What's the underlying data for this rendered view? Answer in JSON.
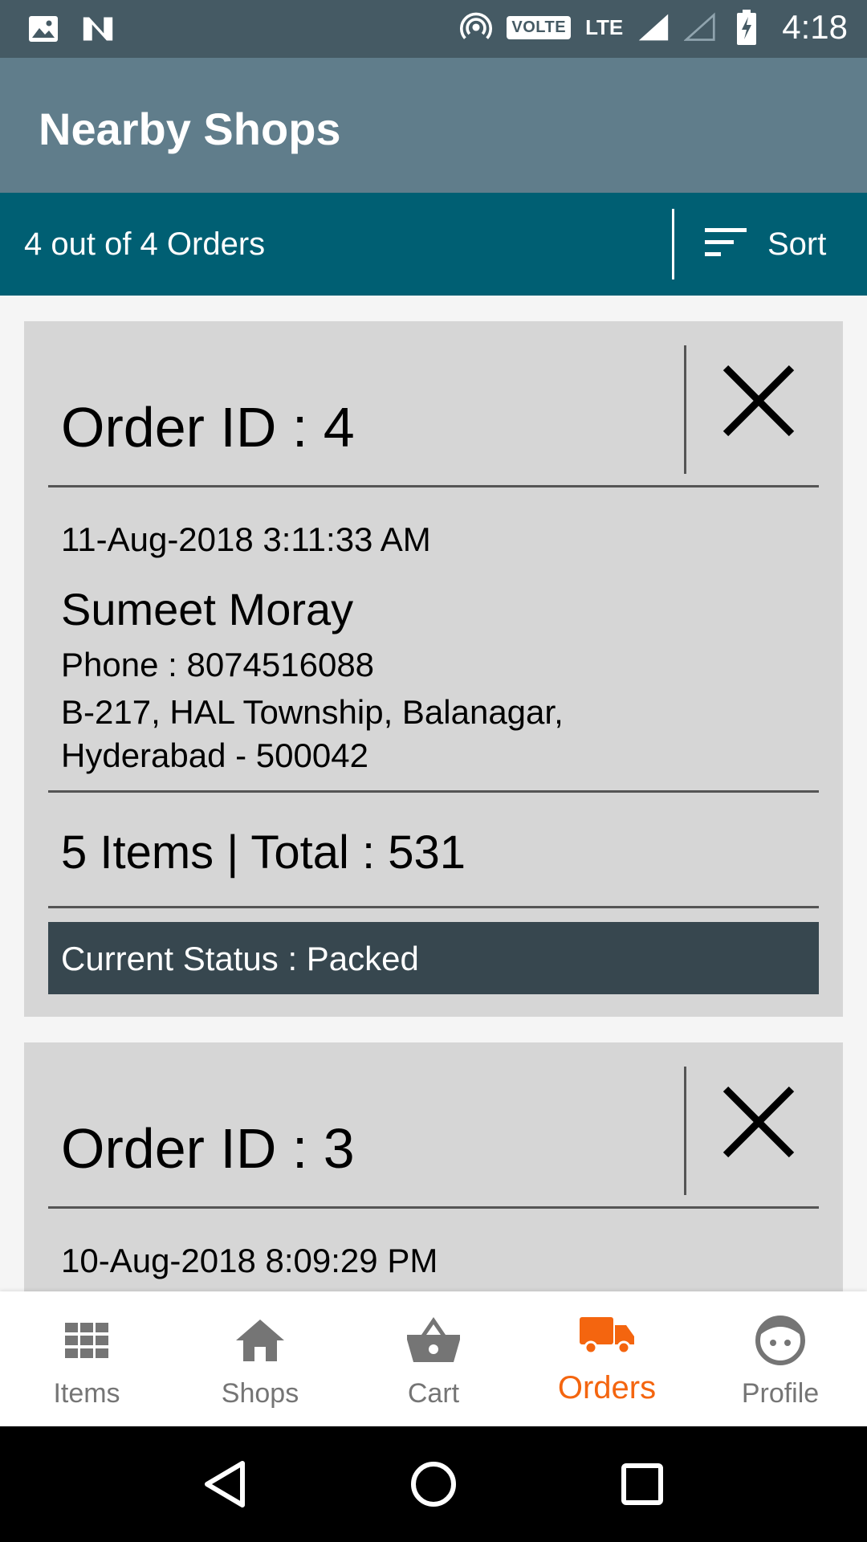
{
  "status_bar": {
    "volte": "VOLTE",
    "lte": "LTE",
    "time": "4:18"
  },
  "app_bar": {
    "title": "Nearby Shops"
  },
  "sub_bar": {
    "order_count": "4 out of 4 Orders",
    "sort_label": "Sort"
  },
  "orders": [
    {
      "order_id": "Order ID : 4",
      "date": "11-Aug-2018 3:11:33 AM",
      "customer": "Sumeet Moray",
      "phone": "Phone : 8074516088",
      "address": "B-217, HAL Township, Balanagar, Hyderabad - 500042",
      "summary": "5 Items  | Total : 531",
      "status": "Current Status : Packed"
    },
    {
      "order_id": "Order ID : 3",
      "date": "10-Aug-2018 8:09:29 PM"
    }
  ],
  "bottom_nav": {
    "items": [
      {
        "label": "Items",
        "icon": "grid-icon"
      },
      {
        "label": "Shops",
        "icon": "home-icon"
      },
      {
        "label": "Cart",
        "icon": "basket-icon"
      },
      {
        "label": "Orders",
        "icon": "truck-icon",
        "active": true
      },
      {
        "label": "Profile",
        "icon": "face-icon"
      }
    ]
  },
  "colors": {
    "status_bar": "#455A64",
    "app_bar": "#607D8B",
    "sub_bar": "#005F73",
    "card": "#D6D6D6",
    "status_strip": "#37474F",
    "accent": "#F4650F"
  }
}
